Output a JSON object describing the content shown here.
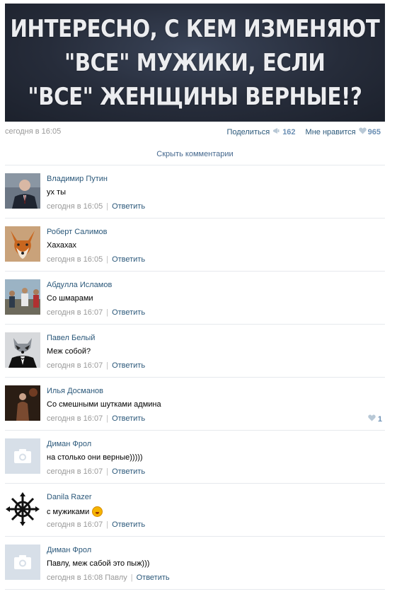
{
  "post": {
    "banner_lines": [
      "ИНТЕРЕСНО, С КЕМ ИЗМЕНЯЮТ",
      "\"ВСЕ\" МУЖИКИ, ЕСЛИ",
      "\"ВСЕ\" ЖЕНЩИНЫ ВЕРНЫЕ!?"
    ],
    "time": "сегодня в 16:05",
    "share_label": "Поделиться",
    "share_icon": "megaphone-icon",
    "share_count": "162",
    "like_label": "Мне нравится",
    "like_icon": "heart-icon",
    "like_count": "965"
  },
  "hide_comments_label": "Скрыть комментарии",
  "reply_label": "Ответить",
  "comments": [
    {
      "author": "Владимир Путин",
      "text": "ух ты",
      "time": "сегодня в 16:05",
      "avatar": "photo-avatar"
    },
    {
      "author": "Роберт Салимов",
      "text": "Хахахах",
      "time": "сегодня в 16:05",
      "avatar": "fox-avatar"
    },
    {
      "author": "Абдулла Исламов",
      "text": "Со шмарами",
      "time": "сегодня в 16:07",
      "avatar": "photo-avatar"
    },
    {
      "author": "Павел Белый",
      "text": "Меж собой?",
      "time": "сегодня в 16:07",
      "avatar": "raccoon-suit-avatar"
    },
    {
      "author": "Илья Досманов",
      "text": "Со смешными шутками админа",
      "time": "сегодня в 16:07",
      "avatar": "photo-avatar",
      "likes": "1"
    },
    {
      "author": "Диман Фрол",
      "text": "на столько они верные)))))",
      "time": "сегодня в 16:07",
      "avatar": "camera-placeholder-icon"
    },
    {
      "author": "Danila Razer",
      "text": "с мужиками",
      "time": "сегодня в 16:07",
      "avatar": "chaos-star-avatar",
      "emoji": "laughing-emoji-icon"
    },
    {
      "author": "Диман Фрол",
      "text": "Павлу, меж сабой это пыж)))",
      "time": "сегодня в 16:08",
      "reply_to": "Павлу",
      "avatar": "camera-placeholder-icon"
    }
  ]
}
